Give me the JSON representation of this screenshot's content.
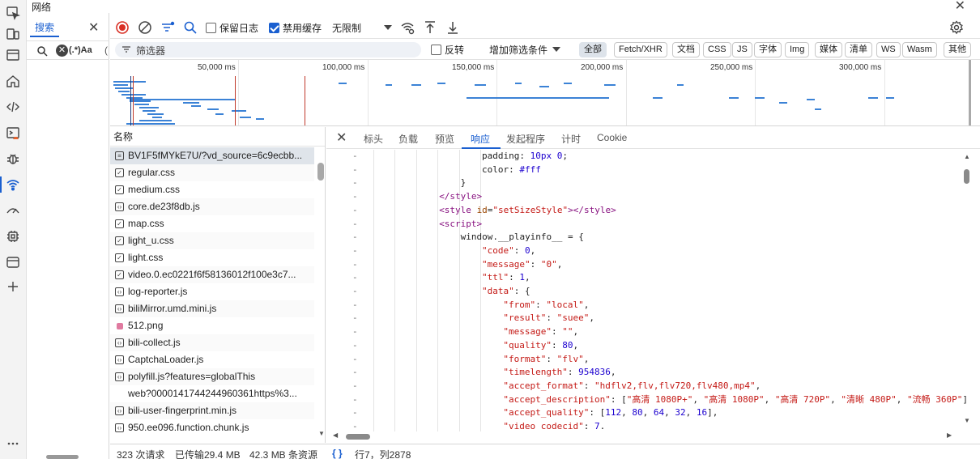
{
  "window": {
    "title": "网络"
  },
  "activity_bar": {
    "icons": [
      "inspect-icon",
      "device-icon",
      "window-icon",
      "home-icon",
      "code-icon",
      "console-icon",
      "bug-icon",
      "network-icon",
      "performance-icon",
      "memory-icon",
      "application-icon",
      "add-icon",
      "more-icon"
    ]
  },
  "search_panel": {
    "tab_label": "搜索",
    "regex_label": "(.*)Aa",
    "paren": "("
  },
  "toolbar": {
    "preserve_log": "保留日志",
    "disable_cache": "禁用缓存",
    "preserve_log_checked": false,
    "disable_cache_checked": true,
    "throttle": "无限制"
  },
  "filter": {
    "placeholder": "筛选器",
    "invert_label": "反转",
    "more_filters": "增加筛选条件",
    "types": [
      "全部",
      "Fetch/XHR",
      "文档",
      "CSS",
      "JS",
      "字体",
      "Img",
      "媒体",
      "清单",
      "WS",
      "Wasm",
      "其他"
    ],
    "selected_type": "全部"
  },
  "overview": {
    "ticks": [
      "50,000 ms",
      "100,000 ms",
      "150,000 ms",
      "200,000 ms",
      "250,000 ms",
      "300,000 ms"
    ]
  },
  "request_list": {
    "header": "名称",
    "items": [
      {
        "name": "BV1F5fMYkE7U/?vd_source=6c9ecbb...",
        "type": "doc"
      },
      {
        "name": "regular.css",
        "type": "css"
      },
      {
        "name": "medium.css",
        "type": "css"
      },
      {
        "name": "core.de23f8db.js",
        "type": "js"
      },
      {
        "name": "map.css",
        "type": "css"
      },
      {
        "name": "light_u.css",
        "type": "css"
      },
      {
        "name": "light.css",
        "type": "css"
      },
      {
        "name": "video.0.ec0221f6f58136012f100e3c7...",
        "type": "css"
      },
      {
        "name": "log-reporter.js",
        "type": "js"
      },
      {
        "name": "biliMirror.umd.mini.js",
        "type": "js"
      },
      {
        "name": "512.png",
        "type": "img"
      },
      {
        "name": "bili-collect.js",
        "type": "js"
      },
      {
        "name": "CaptchaLoader.js",
        "type": "js"
      },
      {
        "name": "polyfill.js?features=globalThis",
        "type": "js"
      },
      {
        "name": "web?0000141744244960361https%3...",
        "type": "none"
      },
      {
        "name": "bili-user-fingerprint.min.js",
        "type": "js"
      },
      {
        "name": "950.ee096.function.chunk.js",
        "type": "js"
      }
    ]
  },
  "details": {
    "tabs": [
      "标头",
      "负载",
      "预览",
      "响应",
      "发起程序",
      "计时",
      "Cookie"
    ],
    "active_tab": "响应",
    "code_lines": [
      {
        "indent": 20,
        "html": "padding: <span class=\"k-num\">10px 0</span>;"
      },
      {
        "indent": 20,
        "html": "color: <span class=\"k-num\">#fff</span>"
      },
      {
        "indent": 16,
        "html": "}"
      },
      {
        "indent": 12,
        "html": "<span class=\"k-tag\">&lt;/style&gt;</span>"
      },
      {
        "indent": 12,
        "html": "<span class=\"k-tag\">&lt;style</span> <span class=\"k-attr\">id</span>=<span class=\"k-str\">\"setSizeStyle\"</span><span class=\"k-tag\">&gt;&lt;/style&gt;</span>"
      },
      {
        "indent": 12,
        "html": "<span class=\"k-tag\">&lt;script&gt;</span>"
      },
      {
        "indent": 16,
        "html": "window.__playinfo__ = {"
      },
      {
        "indent": 20,
        "html": "<span class=\"k-str\">\"code\"</span>: <span class=\"k-num\">0</span>,"
      },
      {
        "indent": 20,
        "html": "<span class=\"k-str\">\"message\"</span>: <span class=\"k-str\">\"0\"</span>,"
      },
      {
        "indent": 20,
        "html": "<span class=\"k-str\">\"ttl\"</span>: <span class=\"k-num\">1</span>,"
      },
      {
        "indent": 20,
        "html": "<span class=\"k-str\">\"data\"</span>: {"
      },
      {
        "indent": 24,
        "html": "<span class=\"k-str\">\"from\"</span>: <span class=\"k-str\">\"local\"</span>,"
      },
      {
        "indent": 24,
        "html": "<span class=\"k-str\">\"result\"</span>: <span class=\"k-str\">\"suee\"</span>,"
      },
      {
        "indent": 24,
        "html": "<span class=\"k-str\">\"message\"</span>: <span class=\"k-str\">\"\"</span>,"
      },
      {
        "indent": 24,
        "html": "<span class=\"k-str\">\"quality\"</span>: <span class=\"k-num\">80</span>,"
      },
      {
        "indent": 24,
        "html": "<span class=\"k-str\">\"format\"</span>: <span class=\"k-str\">\"flv\"</span>,"
      },
      {
        "indent": 24,
        "html": "<span class=\"k-str\">\"timelength\"</span>: <span class=\"k-num\">954836</span>,"
      },
      {
        "indent": 24,
        "html": "<span class=\"k-str\">\"accept_format\"</span>: <span class=\"k-str\">\"hdflv2,flv,flv720,flv480,mp4\"</span>,"
      },
      {
        "indent": 24,
        "html": "<span class=\"k-str\">\"accept_description\"</span>: [<span class=\"k-str\">\"高清 1080P+\"</span>, <span class=\"k-str\">\"高清 1080P\"</span>, <span class=\"k-str\">\"高清 720P\"</span>, <span class=\"k-str\">\"清晰 480P\"</span>, <span class=\"k-str\">\"流畅 360P\"</span>],"
      },
      {
        "indent": 24,
        "html": "<span class=\"k-str\">\"accept_quality\"</span>: [<span class=\"k-num\">112</span>, <span class=\"k-num\">80</span>, <span class=\"k-num\">64</span>, <span class=\"k-num\">32</span>, <span class=\"k-num\">16</span>],"
      },
      {
        "indent": 24,
        "html": "<span class=\"k-str\">\"video codecid\"</span>: <span class=\"k-num\">7</span>."
      }
    ]
  },
  "status": {
    "requests": "323 次请求",
    "transferred": "已传输29.4 MB",
    "resources": "42.3 MB 条资源",
    "cursor": "行7，列2878",
    "braces": "{ }"
  }
}
